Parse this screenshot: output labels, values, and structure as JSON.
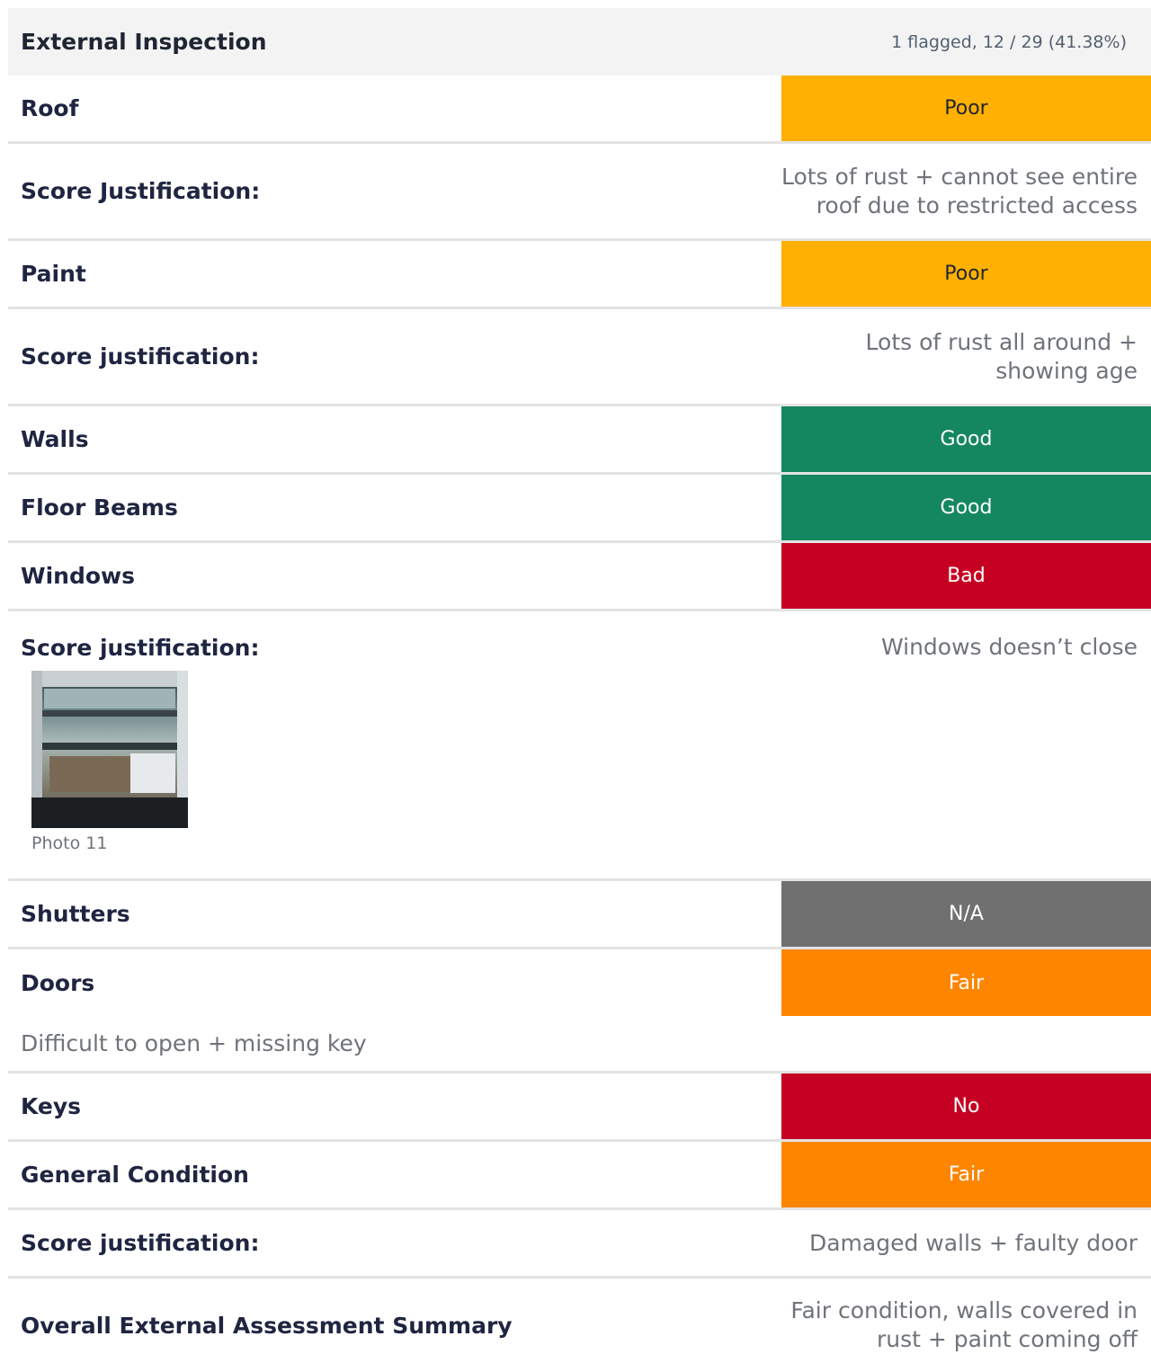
{
  "section": {
    "title": "External Inspection",
    "stats": "1 flagged, 12 / 29 (41.38%)"
  },
  "rows": {
    "roof": {
      "label": "Roof",
      "value": "Poor"
    },
    "roof_just": {
      "label": "Score Justification:",
      "answer": "Lots of rust + cannot see entire roof due to restricted access"
    },
    "paint": {
      "label": "Paint",
      "value": "Poor"
    },
    "paint_just": {
      "label": "Score justification:",
      "answer": "Lots of rust all around + showing age"
    },
    "walls": {
      "label": "Walls",
      "value": "Good"
    },
    "floor_beams": {
      "label": "Floor Beams",
      "value": "Good"
    },
    "windows": {
      "label": "Windows",
      "value": "Bad"
    },
    "windows_just": {
      "label": "Score justification:",
      "answer": "Windows doesn’t close"
    },
    "windows_photo": {
      "caption": "Photo 11"
    },
    "shutters": {
      "label": "Shutters",
      "value": "N/A"
    },
    "doors": {
      "label": "Doors",
      "value": "Fair"
    },
    "doors_note": {
      "text": "Difficult to open + missing key"
    },
    "keys": {
      "label": "Keys",
      "value": "No"
    },
    "general": {
      "label": "General Condition",
      "value": "Fair"
    },
    "general_just": {
      "label": "Score justification:",
      "answer": "Damaged walls + faulty door"
    },
    "summary": {
      "label": "Overall External Assessment Summary",
      "answer": "Fair condition, walls covered in rust + paint coming off"
    }
  },
  "colors": {
    "poor": "#ffb000",
    "good": "#158760",
    "bad": "#c60022",
    "na": "#707070",
    "fair": "#fe8500"
  }
}
